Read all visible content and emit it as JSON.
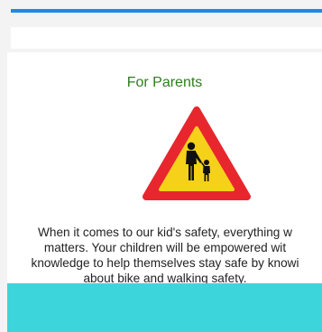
{
  "section": {
    "title": "For Parents",
    "sign_icon": "pedestrian-crossing-warning-sign",
    "body_lines": [
      "When it comes to our kid's safety, everything w",
      "matters. Your children will be empowered wit",
      "knowledge to help themselves stay safe by knowi",
      "about bike and walking safety."
    ]
  },
  "colors": {
    "top_bar": "#1e88e5",
    "title": "#2e7d1e",
    "sign_red": "#e8262e",
    "sign_yellow": "#f6d11a",
    "bottom_bar": "#3dd5dc"
  }
}
